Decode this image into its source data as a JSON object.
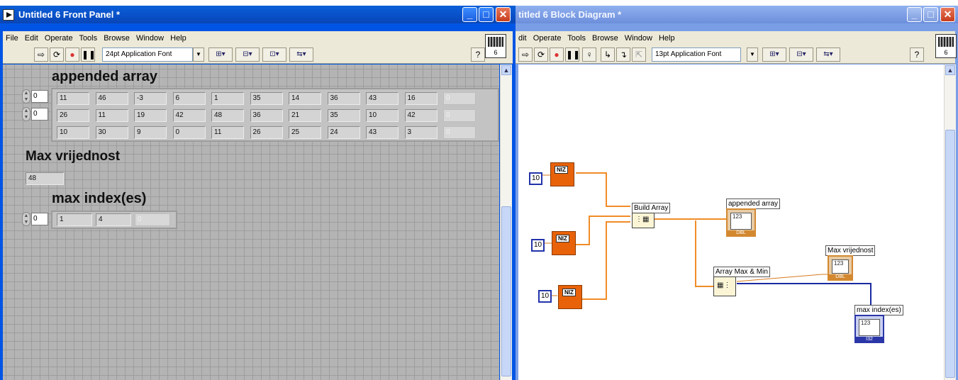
{
  "front_panel": {
    "title": "Untitled 6 Front Panel *",
    "menu": [
      "File",
      "Edit",
      "Operate",
      "Tools",
      "Browse",
      "Window",
      "Help"
    ],
    "font_select": "24pt Application Font",
    "vi_icon_label": "6",
    "appended_array": {
      "label": "appended array",
      "row_index": "0",
      "col_index": "0",
      "rows": [
        [
          "11",
          "46",
          "-3",
          "6",
          "1",
          "35",
          "14",
          "36",
          "43",
          "16",
          "0"
        ],
        [
          "26",
          "11",
          "19",
          "42",
          "48",
          "36",
          "21",
          "35",
          "10",
          "42",
          "0"
        ],
        [
          "10",
          "30",
          "9",
          "0",
          "11",
          "26",
          "25",
          "24",
          "43",
          "3",
          "0"
        ]
      ]
    },
    "max_value": {
      "label": "Max vrijednost",
      "value": "48"
    },
    "max_index": {
      "label": "max index(es)",
      "index": "0",
      "values": [
        "1",
        "4",
        "0"
      ]
    }
  },
  "block_diagram": {
    "title": "titled 6 Block Diagram *",
    "menu": [
      "dit",
      "Operate",
      "Tools",
      "Browse",
      "Window",
      "Help"
    ],
    "font_select": "13pt Application Font",
    "vi_icon_label": "6",
    "constants": [
      "10",
      "10",
      "10"
    ],
    "subvi_label": "NIZ",
    "nodes": {
      "build_array": "Build Array",
      "array_max_min": "Array Max & Min"
    },
    "indicators": {
      "appended_array": "appended array",
      "max_value": "Max vrijednost",
      "max_index": "max index(es)",
      "numeric_glyph": "123",
      "dbl": "DBL",
      "i32": "I32"
    }
  },
  "colors": {
    "fp_title": "#0055e5",
    "bd_title_inactive": "#7a9ee6",
    "orange_wire": "#f08c28",
    "blue_wire": "#1a2aa0"
  }
}
